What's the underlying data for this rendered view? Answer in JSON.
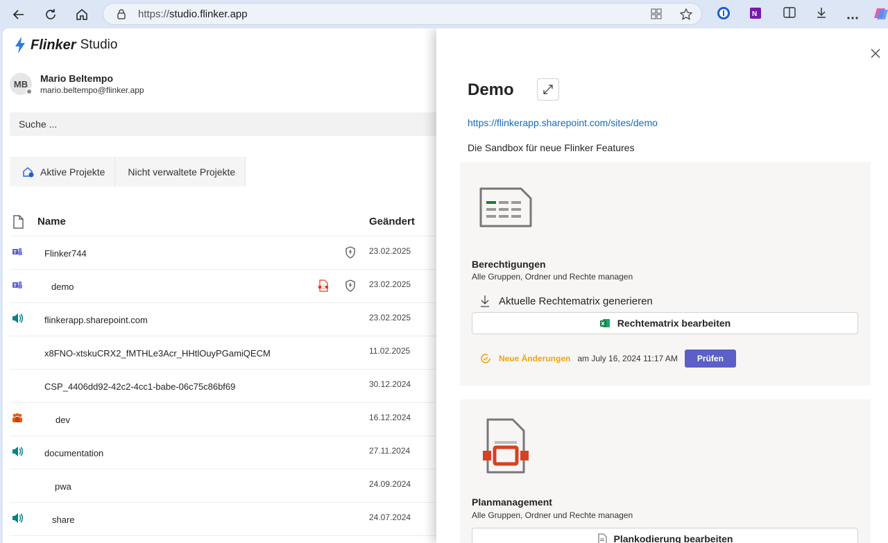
{
  "browser": {
    "url_proto": "https://",
    "url_host": "studio.flinker.app"
  },
  "app": {
    "brand": "Flinker",
    "product": "Studio"
  },
  "user": {
    "initials": "MB",
    "name": "Mario Beltempo",
    "email": "mario.beltempo@flinker.app"
  },
  "search": {
    "placeholder": "Suche ..."
  },
  "tabs": [
    {
      "label": "Aktive Projekte"
    },
    {
      "label": "Nicht verwaltete Projekte"
    }
  ],
  "list": {
    "col_name": "Name",
    "col_date": "Geändert",
    "rows": [
      {
        "name": "Flinker744",
        "date": "23.02.2025",
        "icon": "teams-icon"
      },
      {
        "name": "demo",
        "date": "23.02.2025",
        "icon": "teams-icon"
      },
      {
        "name": "flinkerapp.sharepoint.com",
        "date": "23.02.2025",
        "icon": "sharepoint-icon"
      },
      {
        "name": "x8FNO-xtskuCRX2_fMTHLe3Acr_HHtlOuyPGamiQECM",
        "date": "11.02.2025",
        "icon": ""
      },
      {
        "name": "CSP_4406dd92-42c2-4cc1-babe-06c75c86bf69",
        "date": "30.12.2024",
        "icon": ""
      },
      {
        "name": "dev",
        "date": "16.12.2024",
        "icon": "group-icon"
      },
      {
        "name": "documentation",
        "date": "27.11.2024",
        "icon": "sharepoint-icon"
      },
      {
        "name": "pwa",
        "date": "24.09.2024",
        "icon": ""
      },
      {
        "name": "share",
        "date": "24.07.2024",
        "icon": "sharepoint-icon"
      }
    ]
  },
  "panel": {
    "title": "Demo",
    "link": "https://flinkerapp.sharepoint.com/sites/demo",
    "description": "Die Sandbox für neue Flinker Features",
    "cards": [
      {
        "title": "Berechtigungen",
        "subtitle": "Alle Gruppen, Ordner und Rechte managen",
        "action": "Aktuelle Rechtematrix generieren",
        "button": "Rechtematrix bearbeiten",
        "status_label": "Neue Änderungen",
        "status_time": "am July 16, 2024 11:17 AM",
        "status_button": "Prüfen"
      },
      {
        "title": "Planmanagement",
        "subtitle": "Alle Gruppen, Ordner und Rechte managen",
        "button": "Plankodierung bearbeiten"
      }
    ]
  },
  "colors": {
    "accent": "#5b5fc7",
    "link": "#0f6cbd",
    "warning": "#f2a30f",
    "teams": "#5b5fc7",
    "sharepoint": "#038387",
    "group": "#e8590c"
  }
}
